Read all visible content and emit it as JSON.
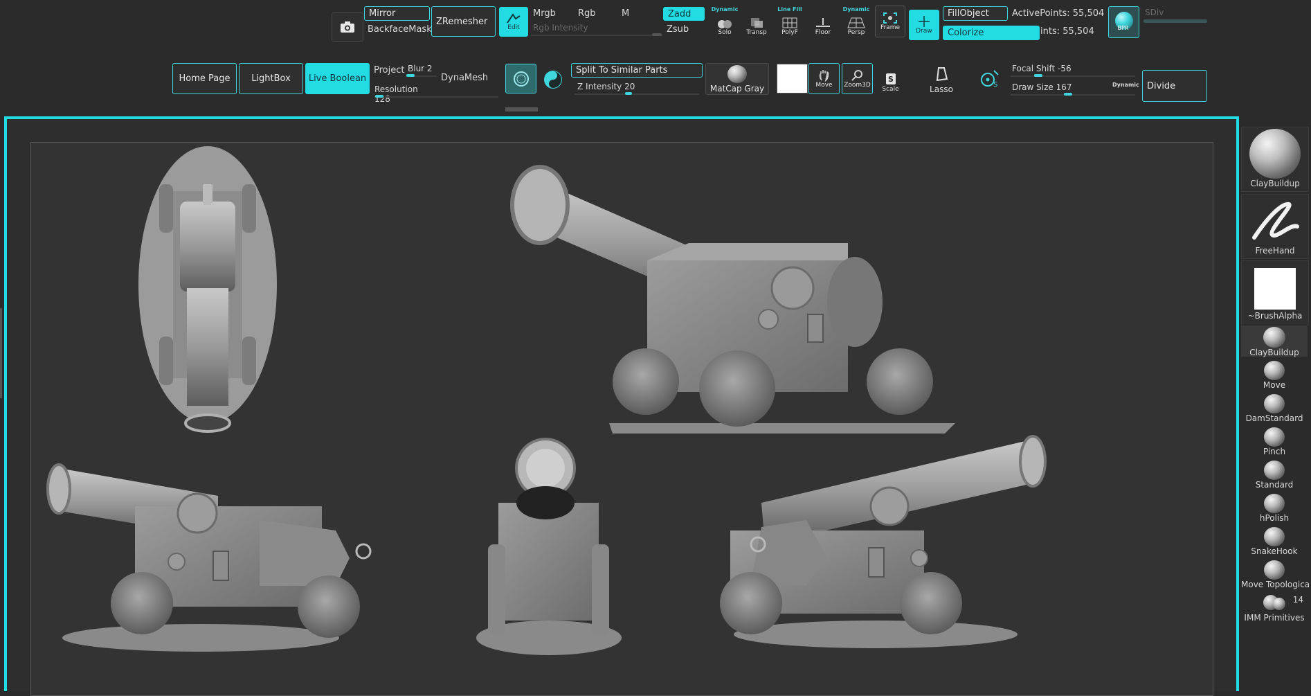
{
  "toolbar_top": {
    "mirror": "Mirror",
    "backface_mask": "BackfaceMask",
    "zremesher": "ZRemesher",
    "edit": "Edit",
    "mrgb": "Mrgb",
    "rgb": "Rgb",
    "m": "M",
    "rgb_intensity": "Rgb Intensity",
    "zadd": "Zadd",
    "zsub": "Zsub",
    "dynamic_solo_top": "Dynamic",
    "solo": "Solo",
    "transp": "Transp",
    "line_fill_top": "Line Fill",
    "polyf": "PolyF",
    "floor": "Floor",
    "dynamic_persp_top": "Dynamic",
    "persp": "Persp",
    "frame": "Frame",
    "draw": "Draw",
    "fill_object": "FillObject",
    "colorize": "Colorize",
    "active_points": "ActivePoints: 55,504",
    "total_points": "ints: 55,504",
    "bpr": "BPR",
    "sdiv": "SDiv"
  },
  "toolbar_second": {
    "home_page": "Home Page",
    "lightbox": "LightBox",
    "live_boolean": "Live Boolean",
    "project": "Project",
    "blur": "Blur 2",
    "resolution": "Resolution 128",
    "dynamesh": "DynaMesh",
    "split_similar": "Split To Similar Parts",
    "z_intensity": "Z Intensity 20",
    "matcap": "MatCap Gray",
    "move": "Move",
    "zoom3d": "Zoom3D",
    "scale": "Scale",
    "lasso": "Lasso",
    "focal_shift": "Focal Shift -56",
    "draw_size": "Draw Size 167",
    "dynamic": "Dynamic",
    "divide": "Divide"
  },
  "sliders": {
    "rgb_intensity": 0.05,
    "blur": 0.1,
    "resolution": 0.05,
    "z_intensity": 0.5,
    "focal_shift": 0.22,
    "draw_size": 0.45,
    "sdiv": 0.0
  },
  "brush_palette": [
    {
      "name": "ClayBuildup",
      "icon": "claybuildup-sphere-icon"
    },
    {
      "name": "FreeHand",
      "icon": "freehand-stroke-icon"
    },
    {
      "name": "~BrushAlpha",
      "icon": "white-alpha-icon"
    },
    {
      "name": "ClayBuildup",
      "icon": "claybuildup-small-icon"
    },
    {
      "name": "Move",
      "icon": "move-brush-icon"
    },
    {
      "name": "DamStandard",
      "icon": "damstandard-brush-icon"
    },
    {
      "name": "Pinch",
      "icon": "pinch-brush-icon"
    },
    {
      "name": "Standard",
      "icon": "standard-brush-icon"
    },
    {
      "name": "hPolish",
      "icon": "hpolish-brush-icon"
    },
    {
      "name": "SnakeHook",
      "icon": "snakehook-brush-icon"
    },
    {
      "name": "Move Topologica",
      "icon": "move-topological-brush-icon"
    },
    {
      "name": "IMM Primitives",
      "icon": "imm-primitives-icon",
      "count": "14"
    }
  ],
  "colors": {
    "accent": "#22dbe3",
    "background": "#2b2b2b",
    "canvas": "#303030"
  },
  "viewport": {
    "models": [
      "cannon-top-view",
      "cannon-perspective-view",
      "cannon-left-view",
      "cannon-front-view",
      "cannon-right-view"
    ]
  }
}
